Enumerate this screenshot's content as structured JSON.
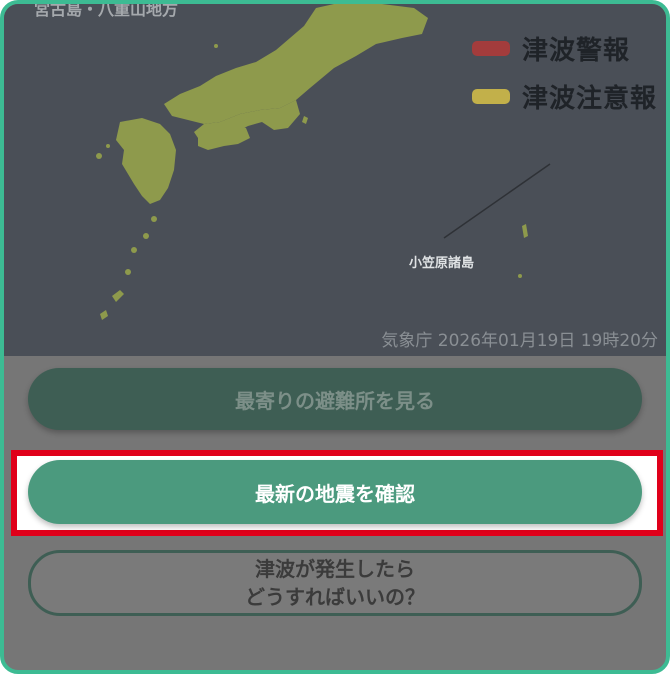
{
  "map": {
    "region_label": "宮古島・八重山地方",
    "legend_top_partial": "",
    "legend": [
      {
        "label": "津波警報",
        "color": "#a33c3c"
      },
      {
        "label": "津波注意報",
        "color": "#c2b04a"
      }
    ],
    "island_label": "小笠原諸島",
    "source": "気象庁 2026年01月19日 19時20分",
    "colors": {
      "sea": "#4a4f57",
      "land": "#8e9a4c",
      "overlay": "#767676"
    }
  },
  "buttons": {
    "shelter": "最寄りの避難所を見る",
    "quake": "最新の地震を確認",
    "guide_line1": "津波が発生したら",
    "guide_line2": "どうすればいいの？"
  },
  "colors": {
    "frame": "#3dbb93",
    "highlight": "#e0001a",
    "primary": "#4b9a7e"
  }
}
